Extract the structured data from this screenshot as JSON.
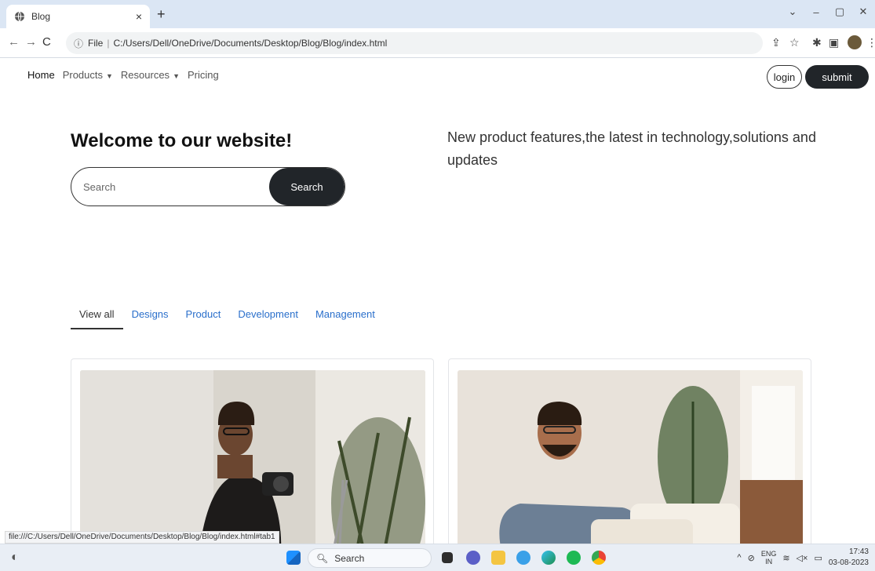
{
  "browser": {
    "tab_title": "Blog",
    "tab_close": "×",
    "new_tab": "+",
    "window_controls": [
      "⌄",
      "–",
      "▢",
      "✕"
    ],
    "address_prefix": "File",
    "address_url": "C:/Users/Dell/OneDrive/Documents/Desktop/Blog/Blog/index.html",
    "status_url": "file:///C:/Users/Dell/OneDrive/Documents/Desktop/Blog/Blog/index.html#tab1"
  },
  "nav": {
    "home": "Home",
    "products": "Products",
    "resources": "Resources",
    "pricing": "Pricing",
    "login": "login",
    "submit": "submit"
  },
  "hero": {
    "title": "Welcome to our website!",
    "search_placeholder": "Search",
    "search_button": "Search",
    "tagline": "New product features,the latest in technology,solutions and updates"
  },
  "category_tabs": [
    "View all",
    "Designs",
    "Product",
    "Development",
    "Management"
  ],
  "taskbar": {
    "search_label": "Search",
    "lang_top": "ENG",
    "lang_bottom": "IN",
    "time": "17:43",
    "date": "03-08-2023"
  },
  "colors": {
    "accent_dark": "#212529",
    "tab_link": "#2a6fcb",
    "chrome_bg": "#dbe6f4"
  }
}
